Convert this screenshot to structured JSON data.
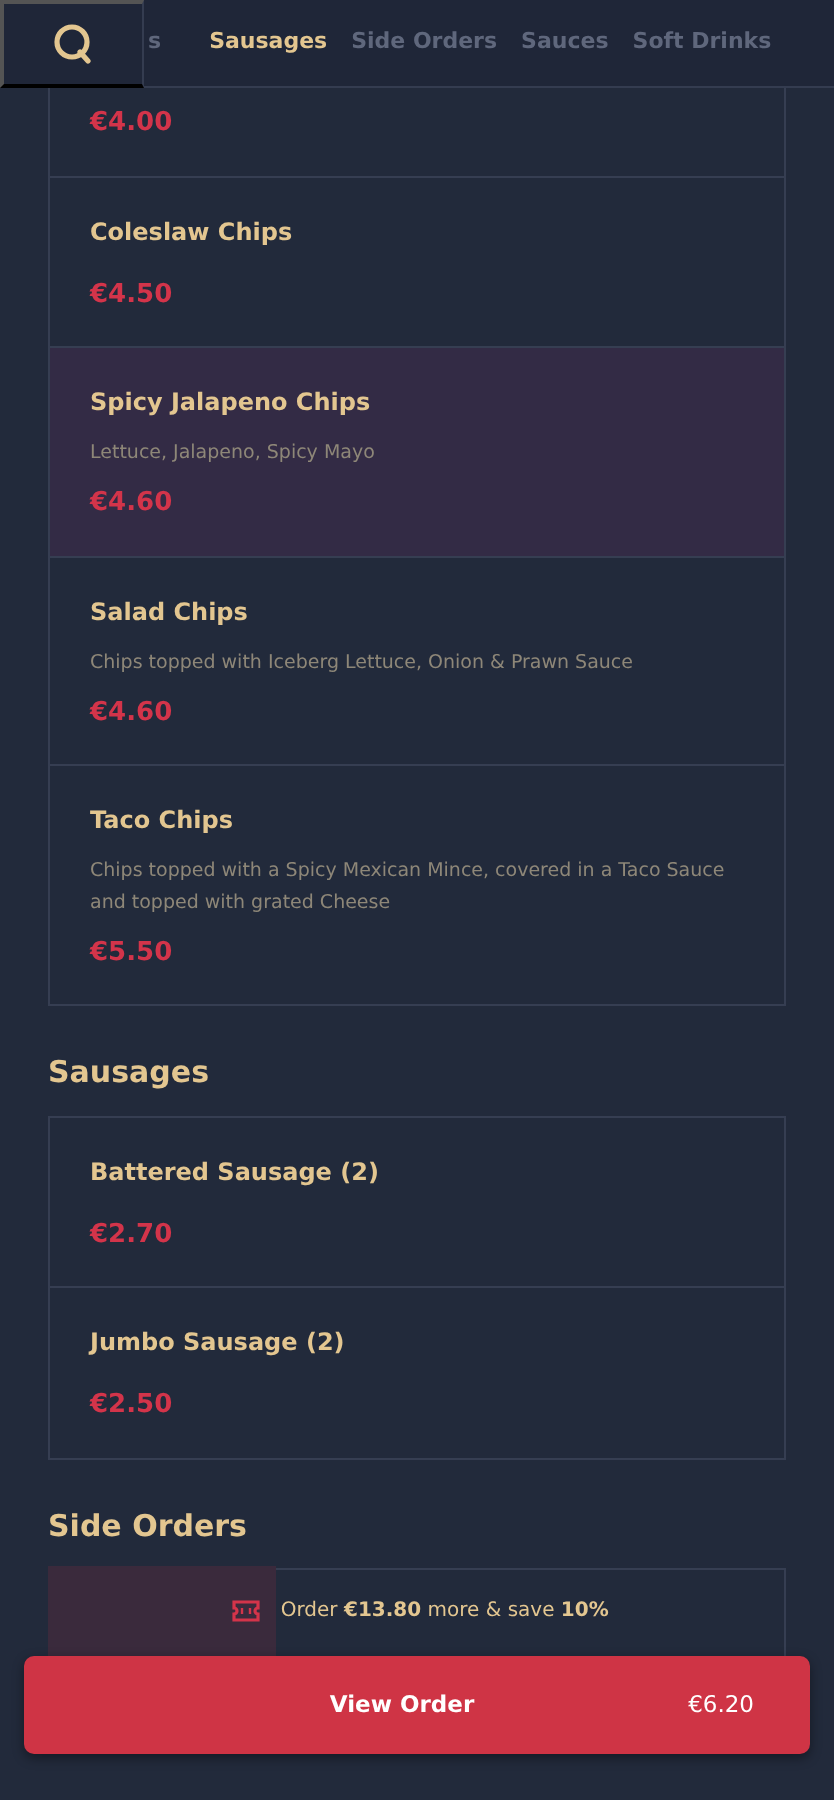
{
  "tabs": [
    {
      "label": "s",
      "selected": false
    },
    {
      "label": "Sausages",
      "selected": true
    },
    {
      "label": "Side Orders",
      "selected": false
    },
    {
      "label": "Sauces",
      "selected": false
    },
    {
      "label": "Soft Drinks",
      "selected": false
    }
  ],
  "sections": [
    {
      "items": [
        {
          "price": "€4.00",
          "highlighted": false
        },
        {
          "name": "Coleslaw Chips",
          "price": "€4.50",
          "highlighted": false
        },
        {
          "name": "Spicy Jalapeno Chips",
          "description": "Lettuce, Jalapeno, Spicy Mayo",
          "price": "€4.60",
          "highlighted": true
        },
        {
          "name": "Salad Chips",
          "description": "Chips topped with Iceberg Lettuce, Onion & Prawn Sauce",
          "price": "€4.60",
          "highlighted": false
        },
        {
          "name": "Taco Chips",
          "description": "Chips topped with a Spicy Mexican Mince, covered in a Taco Sauce and topped with grated Cheese",
          "price": "€5.50",
          "highlighted": false
        }
      ]
    },
    {
      "title": "Sausages",
      "items": [
        {
          "name": "Battered Sausage (2)",
          "price": "€2.70",
          "highlighted": false
        },
        {
          "name": "Jumbo Sausage (2)",
          "price": "€2.50",
          "highlighted": false
        }
      ]
    },
    {
      "title": "Side Orders"
    }
  ],
  "savings": {
    "text": "Order **€13.80** more & save **10%**",
    "level": 0.31
  },
  "order_button": {
    "label": "View Order",
    "total": "€6.20"
  }
}
